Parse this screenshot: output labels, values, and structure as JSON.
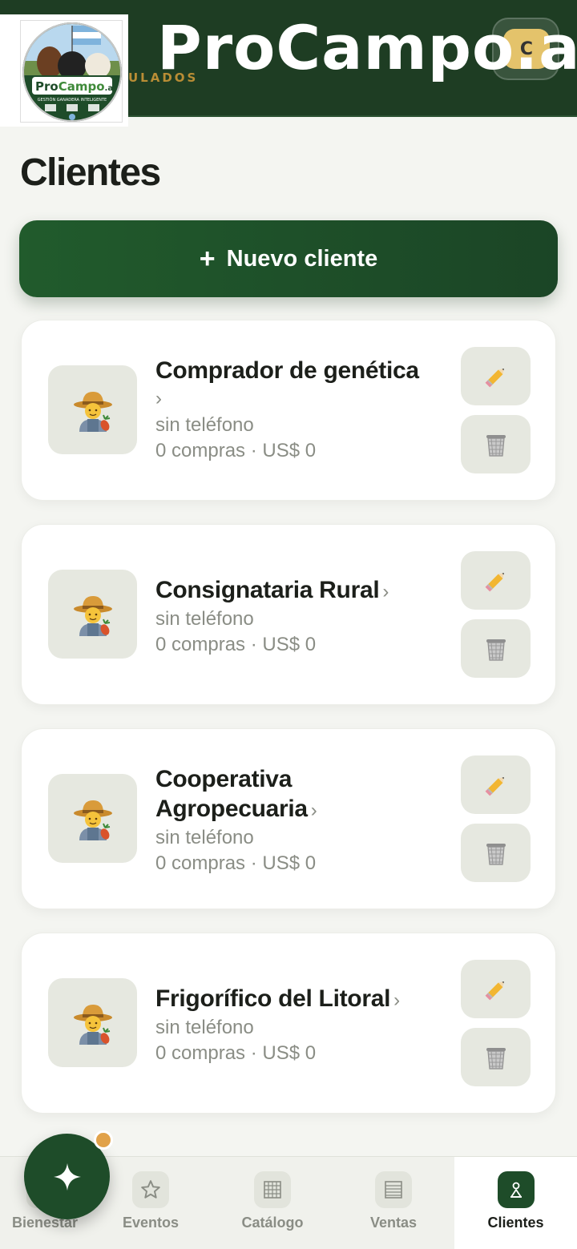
{
  "header": {
    "brand_title": "ProCampo.ar",
    "subtitle_fragment": "ULADOS",
    "user_initial": "C",
    "logo": {
      "brand_pro": "Pro",
      "brand_campo": "Campo",
      "brand_tld": ".ar",
      "tagline": "GESTIÓN GANADERA INTELIGENTE"
    }
  },
  "page": {
    "title": "Clientes",
    "new_client_label": "Nuevo cliente",
    "new_client_icon": "plus-icon"
  },
  "clients": [
    {
      "name": "Comprador de genética",
      "chevron": "›",
      "phone": "sin teléfono",
      "stats": "0 compras · US$ 0"
    },
    {
      "name": "Consignataria Rural",
      "chevron": "›",
      "phone": "sin teléfono",
      "stats": "0 compras · US$ 0"
    },
    {
      "name_line1": "Cooperativa",
      "name_line2": "Agropecuaria",
      "chevron": "›",
      "phone": "sin teléfono",
      "stats": "0 compras · US$ 0"
    },
    {
      "name": "Frigorífico del Litoral",
      "chevron": "›",
      "phone": "sin teléfono",
      "stats": "0 compras · US$ 0"
    }
  ],
  "card_icons": {
    "avatar": "farmer-icon",
    "edit": "pencil-icon",
    "delete": "wastebasket-icon"
  },
  "nav": {
    "items": [
      {
        "label": "Bienestar",
        "icon": "heart-icon"
      },
      {
        "label": "Eventos",
        "icon": "star-icon"
      },
      {
        "label": "Catálogo",
        "icon": "grid-icon"
      },
      {
        "label": "Ventas",
        "icon": "list-icon"
      },
      {
        "label": "Clientes",
        "icon": "person-icon",
        "active": true
      }
    ]
  },
  "fab": {
    "icon": "sparkle-icon",
    "has_notification_dot": true
  },
  "colors": {
    "header_bg": "#1e3d23",
    "accent_green": "#1e4c29",
    "gold": "#b98d35",
    "notification": "#e1a24a"
  }
}
